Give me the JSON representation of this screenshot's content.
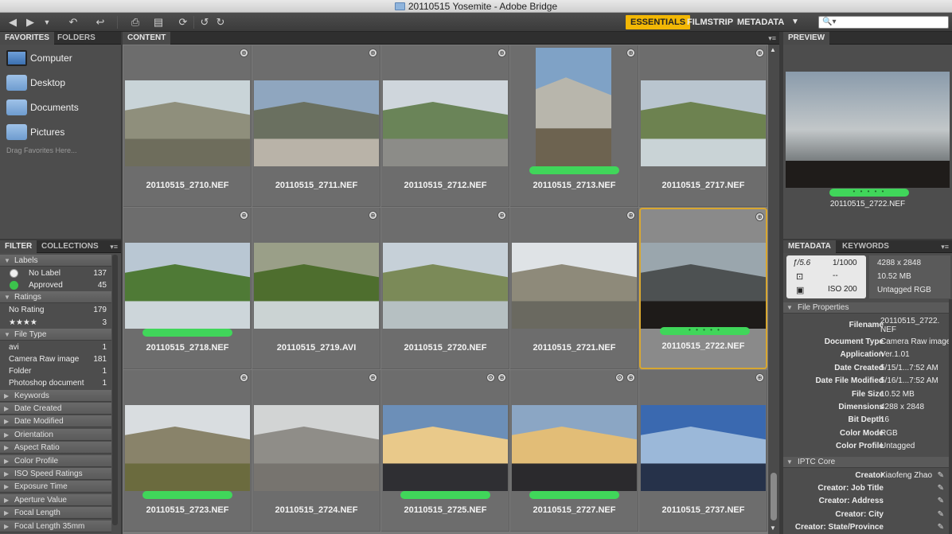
{
  "window": {
    "title": "20110515 Yosemite - Adobe Bridge"
  },
  "toolbar": {
    "workspaces": [
      "ESSENTIALS",
      "FILMSTRIP",
      "METADATA"
    ],
    "active_workspace": "ESSENTIALS",
    "search_placeholder": "🔍▾"
  },
  "favorites_tabs": [
    "FAVORITES",
    "FOLDERS"
  ],
  "favorites": {
    "items": [
      "Computer",
      "Desktop",
      "Documents",
      "Pictures"
    ],
    "hint": "Drag Favorites Here..."
  },
  "filter_tabs": [
    "FILTER",
    "COLLECTIONS"
  ],
  "filter": {
    "labels_title": "Labels",
    "labels": [
      {
        "name": "No Label",
        "count": "137"
      },
      {
        "name": "Approved",
        "count": "45"
      }
    ],
    "ratings_title": "Ratings",
    "ratings": [
      {
        "name": "No Rating",
        "count": "179"
      },
      {
        "name": "★★★★",
        "count": "3"
      }
    ],
    "filetype_title": "File Type",
    "filetypes": [
      {
        "name": "avi",
        "count": "1"
      },
      {
        "name": "Camera Raw image",
        "count": "181"
      },
      {
        "name": "Folder",
        "count": "1"
      },
      {
        "name": "Photoshop document",
        "count": "1"
      }
    ],
    "collapsed": [
      "Keywords",
      "Date Created",
      "Date Modified",
      "Orientation",
      "Aspect Ratio",
      "Color Profile",
      "ISO Speed Ratings",
      "Exposure Time",
      "Aperture Value",
      "Focal Length",
      "Focal Length 35mm"
    ]
  },
  "content": {
    "tab": "CONTENT",
    "items": [
      {
        "name": "20110515_2710.NEF",
        "label": false,
        "selected": false
      },
      {
        "name": "20110515_2711.NEF",
        "label": false,
        "selected": false
      },
      {
        "name": "20110515_2712.NEF",
        "label": false,
        "selected": false
      },
      {
        "name": "20110515_2713.NEF",
        "label": true,
        "selected": false
      },
      {
        "name": "20110515_2717.NEF",
        "label": false,
        "selected": false
      },
      {
        "name": "20110515_2718.NEF",
        "label": true,
        "selected": false
      },
      {
        "name": "20110515_2719.AVI",
        "label": false,
        "selected": false
      },
      {
        "name": "20110515_2720.NEF",
        "label": false,
        "selected": false
      },
      {
        "name": "20110515_2721.NEF",
        "label": false,
        "selected": false
      },
      {
        "name": "20110515_2722.NEF",
        "label": true,
        "selected": true
      },
      {
        "name": "20110515_2723.NEF",
        "label": true,
        "selected": false
      },
      {
        "name": "20110515_2724.NEF",
        "label": false,
        "selected": false
      },
      {
        "name": "20110515_2725.NEF",
        "label": true,
        "selected": false
      },
      {
        "name": "20110515_2727.NEF",
        "label": true,
        "selected": false
      },
      {
        "name": "20110515_2737.NEF",
        "label": false,
        "selected": false
      }
    ]
  },
  "preview": {
    "tab": "PREVIEW",
    "filename": "20110515_2722.NEF"
  },
  "metadata_tabs": [
    "METADATA",
    "KEYWORDS"
  ],
  "metadata": {
    "camera": {
      "aperture": "ƒ/5.6",
      "shutter": "1/1000",
      "dash": "--",
      "iso": "ISO 200",
      "dims": "4288 x 2848",
      "size": "10.52 MB",
      "profile": "Untagged  RGB"
    },
    "file_properties_title": "File Properties",
    "file_properties": [
      {
        "k": "Filename",
        "v": "20110515_2722.NEF"
      },
      {
        "k": "Document Type",
        "v": "Camera Raw image"
      },
      {
        "k": "Application",
        "v": "Ver.1.01"
      },
      {
        "k": "Date Created",
        "v": "5/15/1...7:52 AM"
      },
      {
        "k": "Date File Modified",
        "v": "5/16/1...7:52 AM"
      },
      {
        "k": "File Size",
        "v": "10.52 MB"
      },
      {
        "k": "Dimensions",
        "v": "4288 x 2848"
      },
      {
        "k": "Bit Depth",
        "v": "16"
      },
      {
        "k": "Color Mode",
        "v": "RGB"
      },
      {
        "k": "Color Profile",
        "v": "Untagged"
      }
    ],
    "iptc_title": "IPTC Core",
    "iptc": [
      {
        "k": "Creator",
        "v": "Xiaofeng Zhao"
      },
      {
        "k": "Creator: Job Title",
        "v": ""
      },
      {
        "k": "Creator: Address",
        "v": ""
      },
      {
        "k": "Creator: City",
        "v": ""
      },
      {
        "k": "Creator: State/Province",
        "v": ""
      }
    ]
  },
  "colors": {
    "accent": "#f2b705",
    "label_green": "#40d65a",
    "selection": "#d8a730"
  }
}
